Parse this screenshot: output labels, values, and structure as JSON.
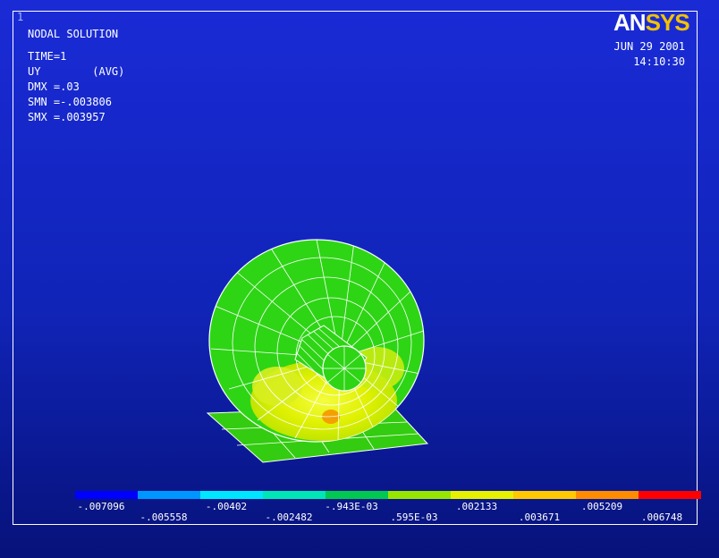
{
  "window": {
    "number": "1"
  },
  "info": {
    "line1": "NODAL SOLUTION",
    "line2": "TIME=1",
    "line3": "UY        (AVG)",
    "line4": "DMX =.03",
    "line5": "SMN =-.003806",
    "line6": "SMX =.003957"
  },
  "logo": {
    "part1": "AN",
    "part2": "SYS"
  },
  "timestamp": {
    "date": "JUN 29 2001",
    "time": "14:10:30"
  },
  "legend": {
    "colors": [
      "#0000ff",
      "#0096ff",
      "#00e6ff",
      "#00e6b4",
      "#00c850",
      "#96e600",
      "#e6f000",
      "#ffc800",
      "#ff8c00",
      "#ff0000"
    ],
    "upper_labels": [
      "-.007096",
      "-.00402",
      "-.943E-03",
      ".002133",
      ".005209"
    ],
    "lower_labels": [
      "-.005558",
      "-.002482",
      ".595E-03",
      ".003671",
      ".006748"
    ]
  }
}
